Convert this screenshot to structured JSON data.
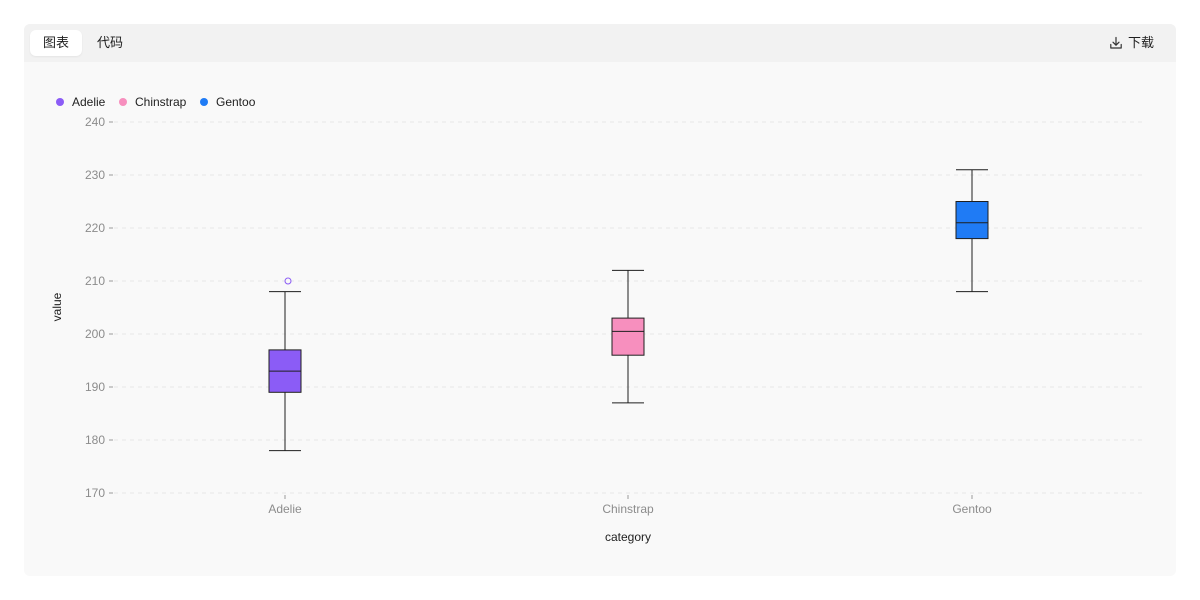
{
  "toolbar": {
    "tabs": [
      {
        "label": "图表",
        "active": true
      },
      {
        "label": "代码",
        "active": false
      }
    ],
    "download_label": "下载",
    "download_icon": "download-icon"
  },
  "chart_data": {
    "type": "boxplot",
    "xlabel": "category",
    "ylabel": "value",
    "ylim": [
      170,
      240
    ],
    "yticks": [
      170,
      180,
      190,
      200,
      210,
      220,
      230,
      240
    ],
    "grid": true,
    "legend_position": "top-left",
    "categories": [
      "Adelie",
      "Chinstrap",
      "Gentoo"
    ],
    "series": [
      {
        "name": "Adelie",
        "color": "#8b5cf6",
        "min": 178,
        "q1": 189,
        "median": 193,
        "q3": 197,
        "max": 208,
        "outliers": [
          210
        ]
      },
      {
        "name": "Chinstrap",
        "color": "#f78fbe",
        "min": 187,
        "q1": 196,
        "median": 200.5,
        "q3": 203,
        "max": 212,
        "outliers": []
      },
      {
        "name": "Gentoo",
        "color": "#1f7bf5",
        "min": 208,
        "q1": 218,
        "median": 221,
        "q3": 225,
        "max": 231,
        "outliers": []
      }
    ]
  }
}
